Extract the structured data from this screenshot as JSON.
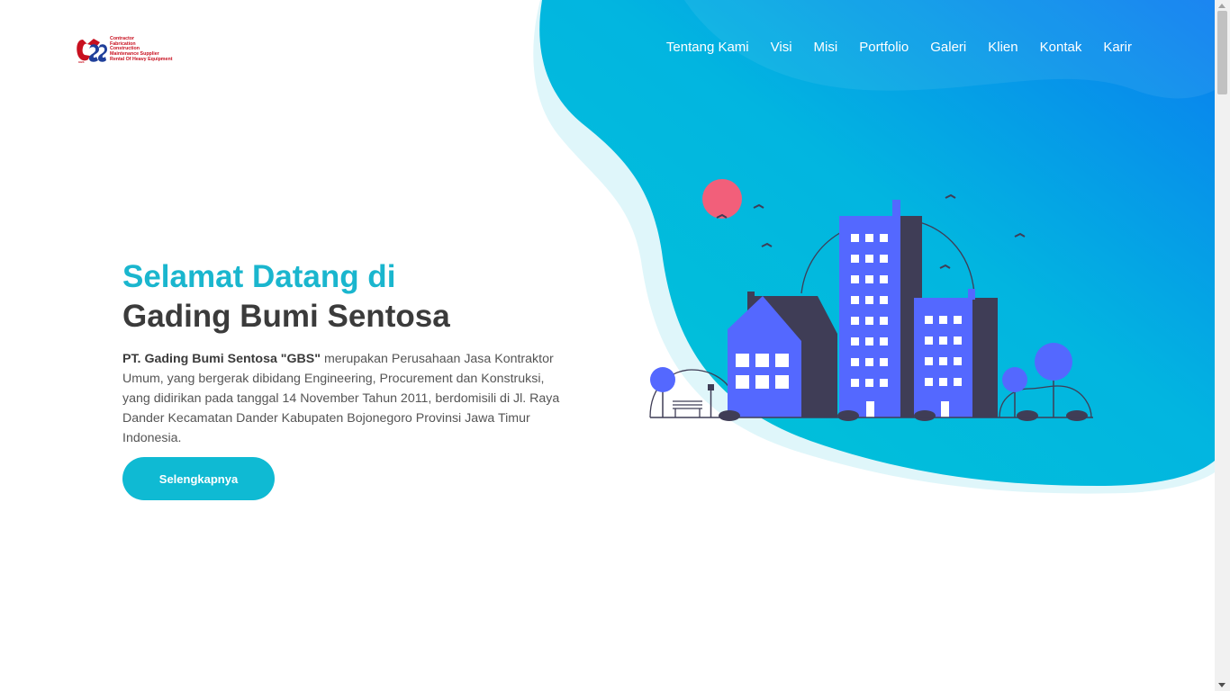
{
  "brand": {
    "logo_text": "GBS",
    "tagline_lines": [
      "Contractor",
      "Fabrication",
      "Construction",
      "Maintenance Supplier",
      "Rental Of Heavy Equipment"
    ]
  },
  "nav": {
    "items": [
      {
        "label": "Tentang Kami"
      },
      {
        "label": "Visi"
      },
      {
        "label": "Misi"
      },
      {
        "label": "Portfolio"
      },
      {
        "label": "Galeri"
      },
      {
        "label": "Klien"
      },
      {
        "label": "Kontak"
      },
      {
        "label": "Karir"
      }
    ]
  },
  "hero": {
    "title_line1": "Selamat Datang di",
    "title_line2": "Gading Bumi Sentosa",
    "company_bold": "PT. Gading Bumi Sentosa \"GBS\"",
    "description": " merupakan Perusahaan Jasa Kontraktor Umum, yang bergerak dibidang Engineering, Procurement dan Konstruksi, yang didirikan pada tanggal 14 November Tahun 2011, berdomisili di Jl. Raya Dander Kecamatan Dander Kabupaten Bojonegoro Provinsi Jawa Timur Indonesia.",
    "cta_label": "Selengkapnya"
  },
  "colors": {
    "accent": "#0fbad3",
    "title_accent": "#1ab6ce",
    "heading_dark": "#3b3b3b",
    "gradient_start": "#00c6d6",
    "gradient_end": "#0a7cf0",
    "building": "#5468ff",
    "building_dark": "#3f3d56",
    "sun": "#f25f7a",
    "logo_red": "#c8101f",
    "logo_blue": "#1f3f9a"
  }
}
